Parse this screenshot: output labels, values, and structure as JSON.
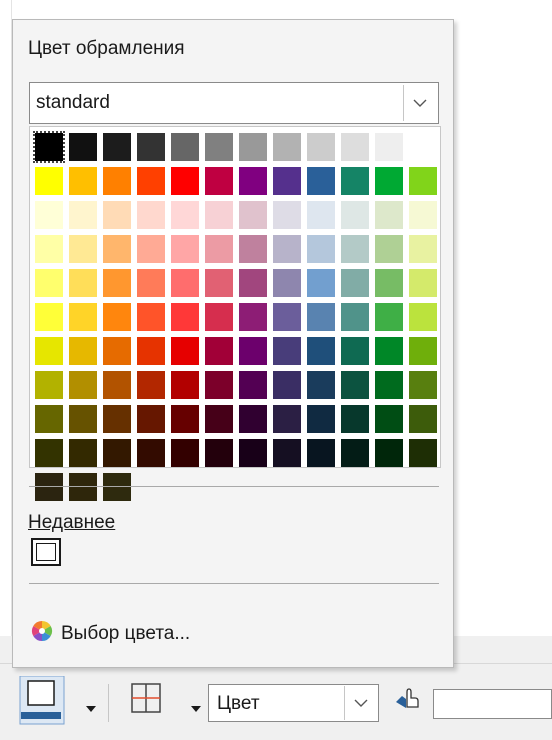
{
  "popup": {
    "title": "Цвет обрамления",
    "palette_select": {
      "value": "standard"
    },
    "palette_colors": [
      "#000000",
      "#111111",
      "#1c1c1c",
      "#333333",
      "#666666",
      "#808080",
      "#999999",
      "#b2b2b2",
      "#cccccc",
      "#dddddd",
      "#eeeeee",
      "#ffffff",
      "#ffff00",
      "#ffbf00",
      "#ff8000",
      "#ff4000",
      "#ff0000",
      "#bf0041",
      "#800080",
      "#55308d",
      "#2a6099",
      "#158466",
      "#00a933",
      "#81d41a",
      "#ffffd7",
      "#fff5ce",
      "#ffdbb6",
      "#ffd8ce",
      "#ffd7d7",
      "#f7d1d5",
      "#e0c2cd",
      "#dedce6",
      "#dee6ef",
      "#dee7e5",
      "#dde8cb",
      "#f6f9d4",
      "#ffffa6",
      "#ffe994",
      "#ffb66c",
      "#ffaa95",
      "#ffa6a6",
      "#ec9ba4",
      "#bf819e",
      "#b7b3ca",
      "#b4c7dc",
      "#b3cac7",
      "#afd095",
      "#e8f2a1",
      "#ffff6d",
      "#ffde59",
      "#ff972f",
      "#ff7b59",
      "#ff6d6d",
      "#e16173",
      "#a1467e",
      "#8e86ae",
      "#729fcf",
      "#81aca6",
      "#77bc65",
      "#d4ea6b",
      "#ffff38",
      "#ffd428",
      "#ff860d",
      "#ff5429",
      "#ff3838",
      "#d62e4e",
      "#8d1d75",
      "#6b5e9b",
      "#5983b0",
      "#50938a",
      "#3faf46",
      "#bbe33d",
      "#e6e600",
      "#e6b800",
      "#e66b00",
      "#e63300",
      "#e60000",
      "#a10037",
      "#6c006c",
      "#483d7a",
      "#1f4f7a",
      "#0f6a52",
      "#008727",
      "#6faf0b",
      "#b2b200",
      "#b28f00",
      "#b25300",
      "#b22700",
      "#b20000",
      "#7c002a",
      "#530053",
      "#3a2e64",
      "#1a3c5c",
      "#0c5340",
      "#006b1e",
      "#587f0f",
      "#666600",
      "#665200",
      "#663000",
      "#661700",
      "#660000",
      "#460018",
      "#300030",
      "#2b1f44",
      "#102a41",
      "#07382c",
      "#004d14",
      "#3d5c0b",
      "#333300",
      "#332900",
      "#331800",
      "#330b00",
      "#330000",
      "#23000c",
      "#180018",
      "#150f22",
      "#081520",
      "#031c16",
      "#00260a",
      "#1e2e05",
      "#2b2410",
      "#2e260b",
      "#2e2a0e"
    ],
    "recent_label": "Недавнее",
    "picker_label": "Выбор цвета..."
  },
  "toolbar": {
    "frame_color_tooltip": "Цвет обрамления",
    "border_style_value": "Цвет",
    "accent_color": "#2a6099"
  }
}
